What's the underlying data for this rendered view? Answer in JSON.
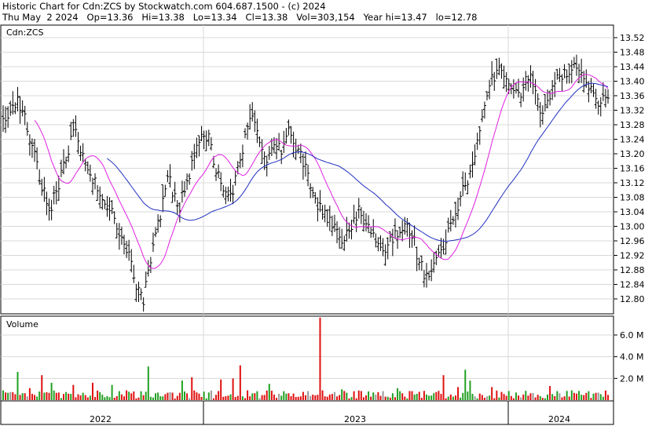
{
  "header": {
    "line1": "Historic Chart for Cdn:ZCS by Stockwatch.com 604.687.1500 - (c) 2024",
    "line2": "Thu May  2 2024   Op=13.36   Hi=13.38   Lo=13.34   Cl=13.38   Vol=303,154   Year hi=13.47   lo=12.78"
  },
  "chart_data": [
    {
      "type": "bar",
      "subtype": "ohlc-price",
      "symbol_label": "Cdn:ZCS",
      "y_ticks": [
        "13.52",
        "13.48",
        "13.44",
        "13.40",
        "13.36",
        "13.32",
        "13.28",
        "13.24",
        "13.20",
        "13.16",
        "13.12",
        "13.08",
        "13.04",
        "13.00",
        "12.96",
        "12.92",
        "12.88",
        "12.84",
        "12.80"
      ],
      "ylim": [
        12.76,
        13.54
      ],
      "grid": true,
      "colors": {
        "bars": "#000000",
        "ma_fast": "#e020e0",
        "ma_slow": "#2030c0"
      },
      "close_keyframes": [
        [
          0,
          13.28
        ],
        [
          6,
          13.34
        ],
        [
          9,
          13.3
        ],
        [
          12,
          13.22
        ],
        [
          15,
          13.14
        ],
        [
          19,
          13.04
        ],
        [
          22,
          13.1
        ],
        [
          26,
          13.18
        ],
        [
          29,
          13.26
        ],
        [
          31,
          13.24
        ],
        [
          34,
          13.18
        ],
        [
          38,
          13.12
        ],
        [
          41,
          13.08
        ],
        [
          45,
          13.04
        ],
        [
          48,
          12.98
        ],
        [
          52,
          12.92
        ],
        [
          55,
          12.84
        ],
        [
          58,
          12.8
        ],
        [
          60,
          12.88
        ],
        [
          63,
          12.98
        ],
        [
          66,
          13.06
        ],
        [
          68,
          13.14
        ],
        [
          70,
          13.1
        ],
        [
          73,
          13.06
        ],
        [
          76,
          13.12
        ],
        [
          79,
          13.2
        ],
        [
          82,
          13.26
        ],
        [
          85,
          13.24
        ],
        [
          88,
          13.16
        ],
        [
          91,
          13.1
        ],
        [
          94,
          13.08
        ],
        [
          97,
          13.16
        ],
        [
          100,
          13.24
        ],
        [
          103,
          13.3
        ],
        [
          106,
          13.22
        ],
        [
          109,
          13.18
        ],
        [
          112,
          13.24
        ],
        [
          115,
          13.2
        ],
        [
          118,
          13.26
        ],
        [
          121,
          13.22
        ],
        [
          124,
          13.18
        ],
        [
          127,
          13.12
        ],
        [
          130,
          13.06
        ],
        [
          134,
          13.02
        ],
        [
          137,
          13.0
        ],
        [
          141,
          12.96
        ],
        [
          144,
          13.0
        ],
        [
          147,
          13.04
        ],
        [
          151,
          13.0
        ],
        [
          155,
          12.96
        ],
        [
          158,
          12.94
        ],
        [
          162,
          12.98
        ],
        [
          166,
          13.0
        ],
        [
          169,
          12.98
        ],
        [
          172,
          12.9
        ],
        [
          175,
          12.86
        ],
        [
          178,
          12.9
        ],
        [
          181,
          12.94
        ],
        [
          184,
          12.98
        ],
        [
          187,
          13.04
        ],
        [
          190,
          13.1
        ],
        [
          193,
          13.14
        ],
        [
          196,
          13.22
        ],
        [
          199,
          13.32
        ],
        [
          202,
          13.4
        ],
        [
          205,
          13.44
        ],
        [
          208,
          13.4
        ],
        [
          211,
          13.38
        ],
        [
          214,
          13.36
        ],
        [
          217,
          13.42
        ],
        [
          220,
          13.38
        ],
        [
          223,
          13.3
        ],
        [
          226,
          13.36
        ],
        [
          229,
          13.4
        ],
        [
          232,
          13.42
        ],
        [
          235,
          13.44
        ],
        [
          238,
          13.42
        ],
        [
          241,
          13.4
        ],
        [
          244,
          13.36
        ],
        [
          247,
          13.34
        ],
        [
          250,
          13.36
        ]
      ],
      "seed": 20240502
    },
    {
      "type": "bar",
      "subtype": "volume",
      "title": "Volume",
      "y_ticks": [
        "6.0 M",
        "4.0 M",
        "2.0 M"
      ],
      "ylim": [
        0,
        7.8
      ],
      "spikes": [
        [
          0,
          0.9,
          "green"
        ],
        [
          6,
          2.6,
          "green"
        ],
        [
          11,
          1.1,
          "red"
        ],
        [
          16,
          2.3,
          "red"
        ],
        [
          20,
          1.6,
          "green"
        ],
        [
          29,
          1.4,
          "red"
        ],
        [
          37,
          1.6,
          "red"
        ],
        [
          45,
          1.4,
          "green"
        ],
        [
          51,
          0.9,
          "red"
        ],
        [
          60,
          3.1,
          "green"
        ],
        [
          74,
          1.8,
          "green"
        ],
        [
          78,
          2.1,
          "red"
        ],
        [
          90,
          1.9,
          "red"
        ],
        [
          95,
          2.0,
          "red"
        ],
        [
          98,
          3.2,
          "red"
        ],
        [
          110,
          1.5,
          "green"
        ],
        [
          131,
          7.6,
          "red"
        ],
        [
          140,
          1.0,
          "green"
        ],
        [
          163,
          1.1,
          "green"
        ],
        [
          182,
          2.3,
          "red"
        ],
        [
          188,
          1.2,
          "red"
        ],
        [
          191,
          2.8,
          "green"
        ],
        [
          193,
          1.8,
          "green"
        ],
        [
          202,
          1.2,
          "red"
        ],
        [
          226,
          1.3,
          "red"
        ],
        [
          246,
          0.7,
          "gray"
        ]
      ],
      "baseline_range": [
        0.15,
        0.9
      ],
      "colors": {
        "up": "#22a022",
        "down": "#e01010",
        "unchanged": "#999999"
      }
    }
  ],
  "x_axis": {
    "labels": [
      "2022",
      "2023",
      "2024"
    ]
  }
}
